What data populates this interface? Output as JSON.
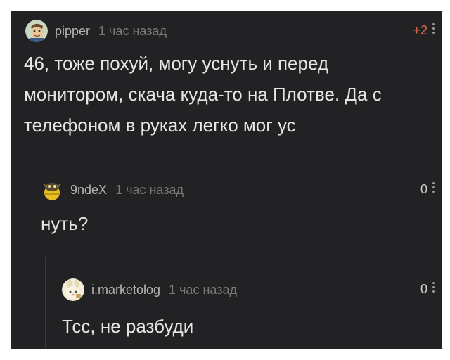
{
  "comments": [
    {
      "username": "pipper",
      "time": "1 час назад",
      "rating": "+2",
      "text_lines": [
        "46, тоже похуй, могу уснуть и перед",
        "монитором, скача куда-то на Плотве. Да с",
        "телефоном в руках легко мог ус"
      ],
      "avatar_icon": "avatar-face-icon",
      "rating_color": "#e26a4a"
    },
    {
      "username": "9ndeX",
      "time": "1 час назад",
      "rating": "0",
      "text_lines": [
        "нуть?"
      ],
      "avatar_icon": "avatar-bee-icon",
      "rating_color": "#d0d0d0"
    },
    {
      "username": "i.marketolog",
      "time": "1 час назад",
      "rating": "0",
      "text_lines": [
        "Тсс, не разбуди"
      ],
      "avatar_icon": "avatar-bunny-icon",
      "rating_color": "#d0d0d0"
    }
  ],
  "colors": {
    "background": "#222224",
    "text": "#e6e6e6",
    "username": "#b4b4b4",
    "time": "#7a7a7a",
    "rating_positive": "#e26a4a"
  }
}
